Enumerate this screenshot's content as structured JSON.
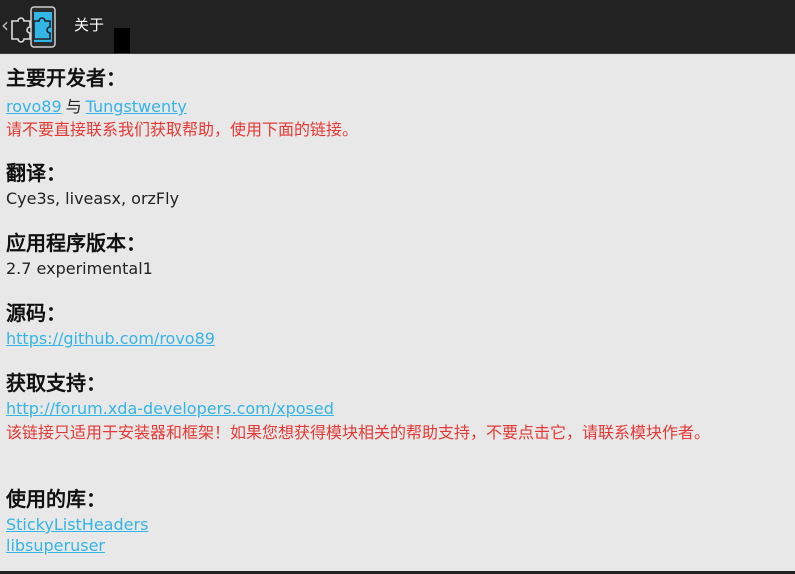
{
  "actionbar": {
    "back_glyph": "‹",
    "app_icon": "xposed-puzzle-icon",
    "title": "关于"
  },
  "sections": {
    "developers": {
      "heading": "主要开发者：",
      "link1": "rovo89",
      "separator": "与",
      "link2": "Tungstwenty",
      "note": "请不要直接联系我们获取帮助，使用下面的链接。"
    },
    "translation": {
      "heading": "翻译：",
      "value": "Cye3s, liveasx, orzFly"
    },
    "version": {
      "heading": "应用程序版本：",
      "value": "2.7 experimental1"
    },
    "source": {
      "heading": "源码：",
      "link": "https://github.com/rovo89"
    },
    "support": {
      "heading": "获取支持：",
      "link": "http://forum.xda-developers.com/xposed",
      "note": "该链接只适用于安装器和框架！如果您想获得模块相关的帮助支持，不要点击它，请联系模块作者。"
    },
    "libraries": {
      "heading": "使用的库：",
      "items": [
        "StickyListHeaders",
        "libsuperuser"
      ]
    }
  },
  "colors": {
    "link": "#33b5e5",
    "warning": "#e53935",
    "actionbar": "#222222",
    "background": "#e8e8e8"
  }
}
